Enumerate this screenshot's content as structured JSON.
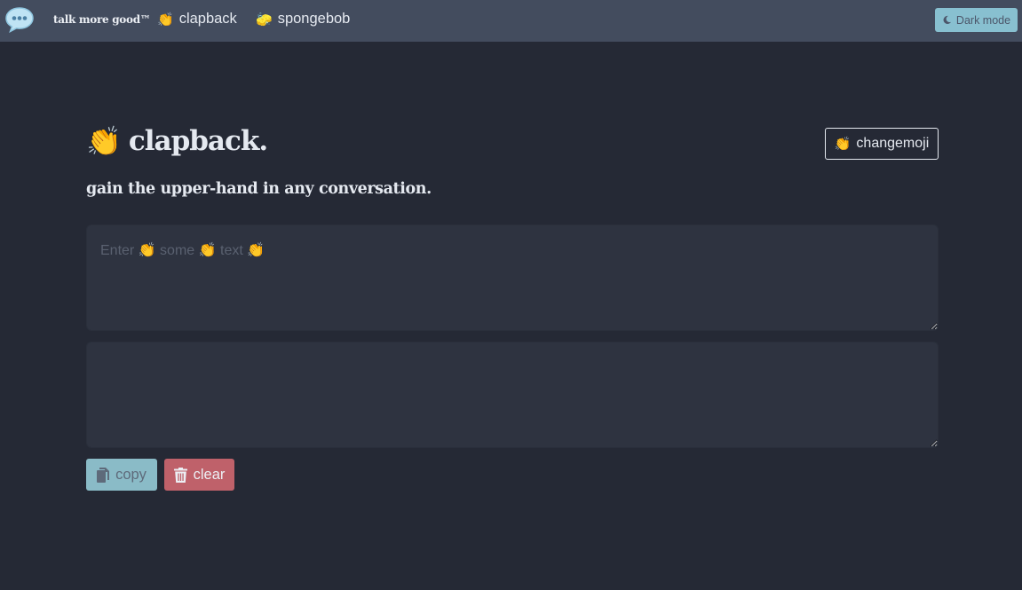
{
  "navbar": {
    "brand": "talk more good™",
    "links": [
      {
        "emoji": "👏",
        "label": "clapback"
      },
      {
        "emoji": "🧽",
        "label": "spongebob"
      }
    ],
    "dark_mode_label": "Dark mode"
  },
  "main": {
    "title_emoji": "👏",
    "title": "clapback.",
    "subtitle": "gain the upper-hand in any conversation.",
    "changemoji_emoji": "👏",
    "changemoji_label": "changemoji",
    "input": {
      "placeholder": "Enter 👏 some 👏 text 👏",
      "value": ""
    },
    "output": {
      "value": ""
    },
    "copy_label": "copy",
    "clear_label": "clear"
  },
  "colors": {
    "background": "#252935",
    "navbar": "#434c5e",
    "accent": "#88c0d0",
    "danger": "#bf616a"
  }
}
